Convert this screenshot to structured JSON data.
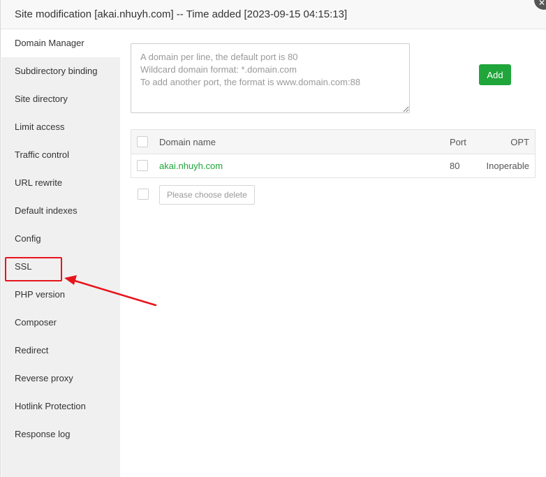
{
  "dialog": {
    "title": "Site modification [akai.nhuyh.com] -- Time added [2023-09-15 04:15:13]",
    "close_glyph": "✕"
  },
  "sidebar": {
    "items": [
      {
        "label": "Domain Manager",
        "active": true
      },
      {
        "label": "Subdirectory binding"
      },
      {
        "label": "Site directory"
      },
      {
        "label": "Limit access"
      },
      {
        "label": "Traffic control"
      },
      {
        "label": "URL rewrite"
      },
      {
        "label": "Default indexes"
      },
      {
        "label": "Config"
      },
      {
        "label": "SSL",
        "highlighted": true
      },
      {
        "label": "PHP version"
      },
      {
        "label": "Composer"
      },
      {
        "label": "Redirect"
      },
      {
        "label": "Reverse proxy"
      },
      {
        "label": "Hotlink Protection"
      },
      {
        "label": "Response log"
      }
    ]
  },
  "domain_form": {
    "placeholder": "A domain per line, the default port is 80\nWildcard domain format: *.domain.com\nTo add another port, the format is www.domain.com:88",
    "add_label": "Add"
  },
  "domain_table": {
    "headers": {
      "name": "Domain name",
      "port": "Port",
      "opt": "OPT"
    },
    "rows": [
      {
        "domain": "akai.nhuyh.com",
        "port": "80",
        "opt": "Inoperable"
      }
    ]
  },
  "bulk_actions": {
    "delete_label": "Please choose delete"
  },
  "colors": {
    "accent": "#20a53a",
    "annotation": "#e8141c"
  }
}
